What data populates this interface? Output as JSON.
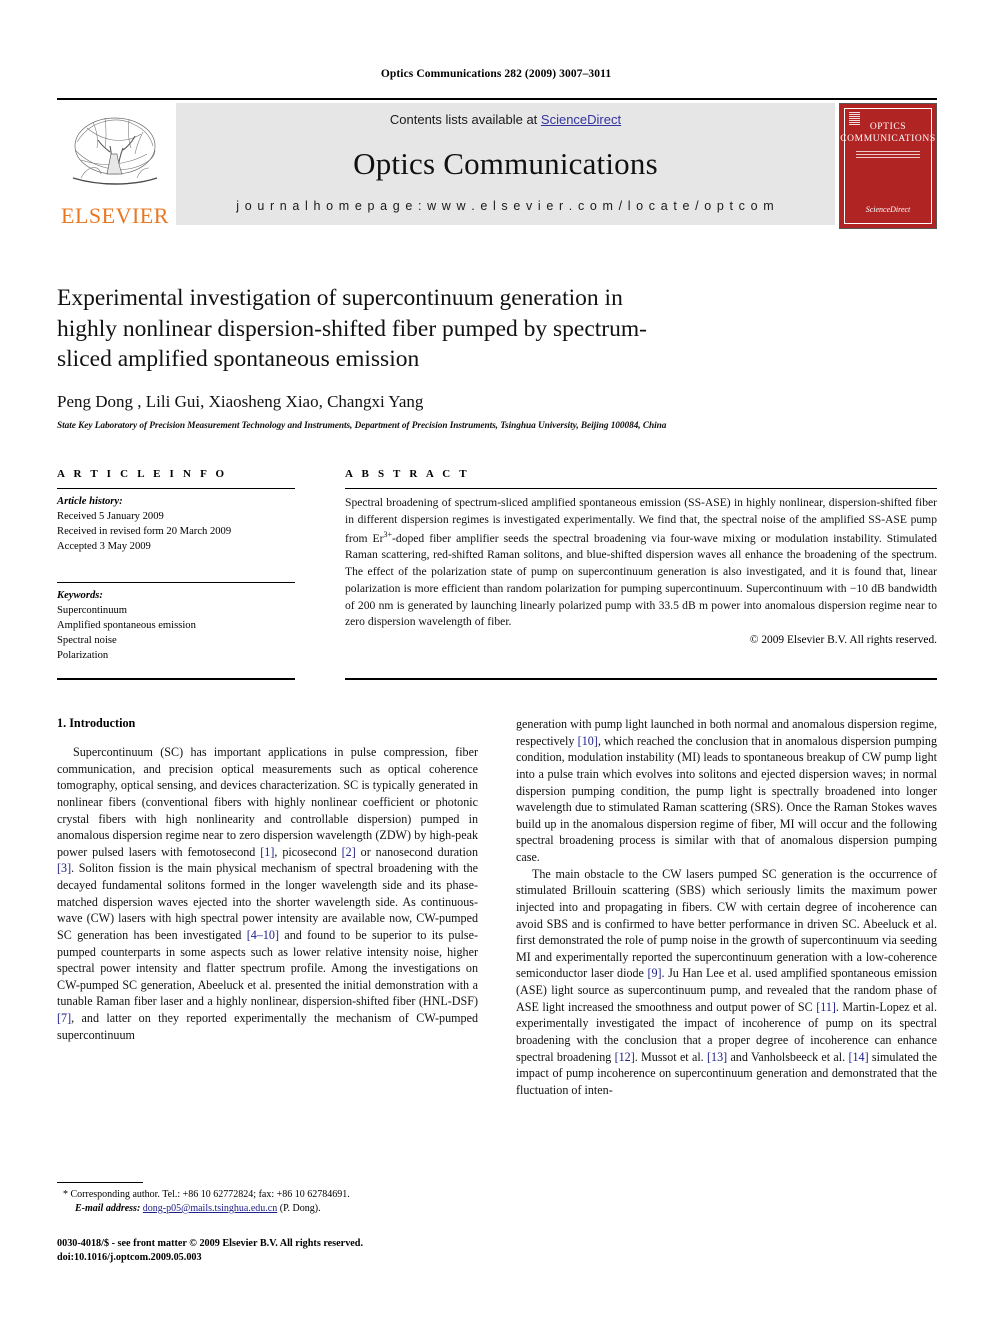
{
  "running_head": "Optics Communications 282 (2009) 3007–3011",
  "masthead": {
    "publisher_name": "ELSEVIER",
    "contents_prefix": "Contents lists available at ",
    "contents_link": "ScienceDirect",
    "journal_title": "Optics Communications",
    "homepage_line": "j o u r n a l   h o m e p a g e :   w w w . e l s e v i e r . c o m / l o c a t e / o p t c o m",
    "cover": {
      "title_line1": "OPTICS",
      "title_line2": "COMMUNICATIONS",
      "footer_publisher": "ScienceDirect"
    }
  },
  "title": "Experimental investigation of supercontinuum generation in highly nonlinear dispersion-shifted fiber pumped by spectrum-sliced amplified spontaneous emission",
  "authors": "Peng Dong , Lili Gui, Xiaosheng Xiao, Changxi Yang",
  "author_marker": "*",
  "affiliation": "State Key Laboratory of Precision Measurement Technology and Instruments, Department of Precision Instruments, Tsinghua University, Beijing 100084, China",
  "article_info": {
    "heading": "A R T I C L E   I N F O",
    "history_label": "Article history:",
    "history": [
      "Received 5 January 2009",
      "Received in revised form 20 March 2009",
      "Accepted 3 May 2009"
    ],
    "keywords_label": "Keywords:",
    "keywords": [
      "Supercontinuum",
      "Amplified spontaneous emission",
      "Spectral noise",
      "Polarization"
    ]
  },
  "abstract": {
    "heading": "A B S T R A C T",
    "part1": "Spectral broadening of spectrum-sliced amplified spontaneous emission (SS-ASE) in highly nonlinear, dispersion-shifted fiber in different dispersion regimes is investigated experimentally. We find that, the spectral noise of the amplified SS-ASE pump from Er",
    "superscript": "3+",
    "part2": "-doped fiber amplifier seeds the spectral broadening via four-wave mixing or modulation instability. Stimulated Raman scattering, red-shifted Raman solitons, and blue-shifted dispersion waves all enhance the broadening of the spectrum. The effect of the polarization state of pump on supercontinuum generation is also investigated, and it is found that, linear polarization is more efficient than random polarization for pumping supercontinuum. Supercontinuum with −10 dB bandwidth of 200 nm is generated by launching linearly polarized pump with 33.5 dB m power into anomalous dispersion regime near to zero dispersion wavelength of fiber.",
    "copyright": "© 2009 Elsevier B.V. All rights reserved."
  },
  "body": {
    "section_number_title": "1. Introduction",
    "left_para1_a": "Supercontinuum (SC) has important applications in pulse compression, fiber communication, and precision optical measurements such as optical coherence tomography, optical sensing, and devices characterization. SC is typically generated in nonlinear fibers (conventional fibers with highly nonlinear coefficient or photonic crystal fibers with high nonlinearity and controllable dispersion) pumped in anomalous dispersion regime near to zero dispersion wavelength (ZDW) by high-peak power pulsed lasers with femotosecond ",
    "ref_1": "[1]",
    "left_para1_b": ", picosecond ",
    "ref_2": "[2]",
    "left_para1_c": " or nanosecond duration ",
    "ref_3": "[3]",
    "left_para1_d": ". Soliton fission is the main physical mechanism of spectral broadening with the decayed fundamental solitons formed in the longer wavelength side and its phase-matched dispersion waves ejected into the shorter wavelength side. As continuous-wave (CW) lasers with high spectral power intensity are available now, CW-pumped SC generation has been investigated ",
    "ref_4_10": "[4–10]",
    "left_para1_e": " and found to be superior to its pulse-pumped counterparts in some aspects such as lower relative intensity noise, higher spectral power intensity and flatter spectrum profile. Among the investigations on CW-pumped SC generation, Abeeluck et al. presented the initial demonstration with a tunable Raman fiber laser and a highly nonlinear, dispersion-shifted fiber (HNL-DSF) ",
    "ref_7": "[7]",
    "left_para1_f": ", and latter on they reported experimentally the mechanism of CW-pumped supercontinuum",
    "right_para1_a": "generation with pump light launched in both normal and anomalous dispersion regime, respectively ",
    "ref_10": "[10]",
    "right_para1_b": ", which reached the conclusion that in anomalous dispersion pumping condition, modulation instability (MI) leads to spontaneous breakup of CW pump light into a pulse train which evolves into solitons and ejected dispersion waves; in normal dispersion pumping condition, the pump light is spectrally broadened into longer wavelength due to stimulated Raman scattering (SRS). Once the Raman Stokes waves build up in the anomalous dispersion regime of fiber, MI will occur and the following spectral broadening process is similar with that of anomalous dispersion pumping case.",
    "right_para2_a": "The main obstacle to the CW lasers pumped SC generation is the occurrence of stimulated Brillouin scattering (SBS) which seriously limits the maximum power injected into and propagating in fibers. CW with certain degree of incoherence can avoid SBS and is confirmed to have better performance in driven SC. Abeeluck et al. first demonstrated the role of pump noise in the growth of supercontinuum via seeding MI and experimentally reported the supercontinuum generation with a low-coherence semiconductor laser diode ",
    "ref_9": "[9]",
    "right_para2_b": ". Ju Han Lee et al. used amplified spontaneous emission (ASE) light source as supercontinuum pump, and revealed that the random phase of ASE light increased the smoothness and output power of SC ",
    "ref_11": "[11]",
    "right_para2_c": ". Martin-Lopez et al. experimentally investigated the impact of incoherence of pump on its spectral broadening with the conclusion that a proper degree of incoherence can enhance spectral broadening ",
    "ref_12": "[12]",
    "right_para2_d": ". Mussot et al. ",
    "ref_13": "[13]",
    "right_para2_e": " and Vanholsbeeck et al. ",
    "ref_14": "[14]",
    "right_para2_f": " simulated the impact of pump incoherence on supercontinuum generation and demonstrated that the fluctuation of inten-"
  },
  "footnote": {
    "marker": "*",
    "line1": "Corresponding author. Tel.: +86 10 62772824; fax: +86 10 62784691.",
    "email_label": "E-mail address:",
    "email": "dong-p05@mails.tsinghua.edu.cn",
    "email_suffix": " (P. Dong)."
  },
  "imprint": {
    "line1": "0030-4018/$ - see front matter © 2009 Elsevier B.V. All rights reserved.",
    "line2": "doi:10.1016/j.optcom.2009.05.003"
  },
  "colors": {
    "elsevier_orange": "#E87722",
    "link_blue": "#33339e",
    "citation_blue": "#20208c",
    "cover_red": "#b02524",
    "band_gray": "#e6e6e6"
  }
}
